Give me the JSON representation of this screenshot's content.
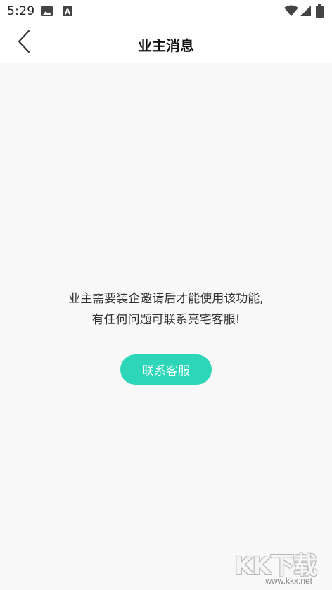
{
  "status_bar": {
    "time": "5:29",
    "icons_left": [
      "image-icon",
      "a-badge-icon"
    ],
    "icons_right": [
      "wifi-icon",
      "signal-icon",
      "battery-icon"
    ]
  },
  "header": {
    "title": "业主消息",
    "back_icon": "chevron-left-icon"
  },
  "main": {
    "message_line1": "业主需要装企邀请后才能使用该功能,",
    "message_line2": "有任何问题可联系亮宅客服!",
    "contact_button_label": "联系客服"
  },
  "watermark": {
    "logo_text": "KK下载",
    "url": "www.kkx.net"
  },
  "colors": {
    "accent": "#2dd6b8",
    "background": "#f8f8f8"
  }
}
